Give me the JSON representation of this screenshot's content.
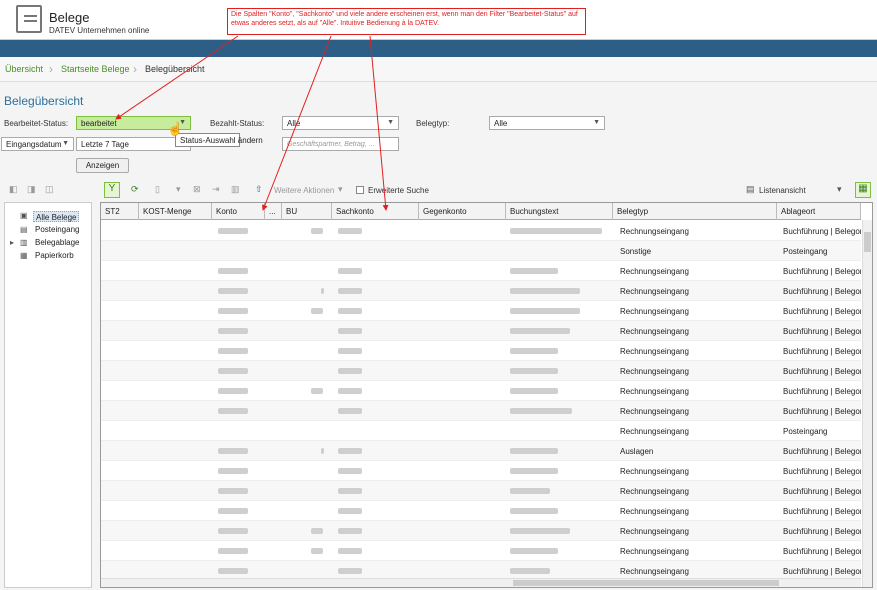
{
  "app": {
    "title": "Belege",
    "subtitle": "DATEV Unternehmen online"
  },
  "annotation": "Die Spalten \"Konto\", \"Sachkonto\" und viele andere erscheinen erst, wenn man den Filter \"Bearbeitet-Status\" auf etwas anderes setzt, als auf \"Alle\". Intuitive Bedienung à la DATEV.",
  "breadcrumb": [
    "Übersicht",
    "Startseite Belege",
    "Belegübersicht"
  ],
  "page_title": "Belegübersicht",
  "filters": {
    "bearbeitet_label": "Bearbeitet-Status:",
    "bearbeitet_value": "bearbeitet",
    "bezahlt_label": "Bezahlt-Status:",
    "bezahlt_value": "Alle",
    "belegtyp_label": "Belegtyp:",
    "belegtyp_value": "Alle",
    "date_field": "Eingangsdatum",
    "date_range": "Letzte 7 Tage",
    "search_placeholder": "Geschäftspartner, Betrag, ...",
    "show_button": "Anzeigen",
    "tooltip": "Status-Auswahl ändern"
  },
  "toolbar": {
    "more_actions": "Weitere Aktionen",
    "extended_search": "Erweiterte Suche",
    "view": "Listenansicht"
  },
  "tree": [
    "Alle Belege",
    "Posteingang",
    "Belegablage",
    "Papierkorb"
  ],
  "columns": [
    "ST2",
    "KOST-Menge",
    "Konto",
    "...",
    "BU",
    "Sachkonto",
    "Gegenkonto",
    "Buchungstext",
    "Belegtyp",
    "Ablageort"
  ],
  "rows": [
    {
      "belegtyp": "Rechnungseingang",
      "ablageort": "Buchführung | Belegor"
    },
    {
      "belegtyp": "Sonstige",
      "ablageort": "Posteingang"
    },
    {
      "belegtyp": "Rechnungseingang",
      "ablageort": "Buchführung | Belegor"
    },
    {
      "belegtyp": "Rechnungseingang",
      "ablageort": "Buchführung | Belegor"
    },
    {
      "belegtyp": "Rechnungseingang",
      "ablageort": "Buchführung | Belegor"
    },
    {
      "belegtyp": "Rechnungseingang",
      "ablageort": "Buchführung | Belegor"
    },
    {
      "belegtyp": "Rechnungseingang",
      "ablageort": "Buchführung | Belegor"
    },
    {
      "belegtyp": "Rechnungseingang",
      "ablageort": "Buchführung | Belegor"
    },
    {
      "belegtyp": "Rechnungseingang",
      "ablageort": "Buchführung | Belegor"
    },
    {
      "belegtyp": "Rechnungseingang",
      "ablageort": "Buchführung | Belegor"
    },
    {
      "belegtyp": "Rechnungseingang",
      "ablageort": "Posteingang"
    },
    {
      "belegtyp": "Auslagen",
      "ablageort": "Buchführung | Belegor"
    },
    {
      "belegtyp": "Rechnungseingang",
      "ablageort": "Buchführung | Belegor"
    },
    {
      "belegtyp": "Rechnungseingang",
      "ablageort": "Buchführung | Belegor"
    },
    {
      "belegtyp": "Rechnungseingang",
      "ablageort": "Buchführung | Belegor"
    },
    {
      "belegtyp": "Rechnungseingang",
      "ablageort": "Buchführung | Belegor"
    },
    {
      "belegtyp": "Rechnungseingang",
      "ablageort": "Buchführung | Belegor"
    },
    {
      "belegtyp": "Rechnungseingang",
      "ablageort": "Buchführung | Belegor"
    }
  ]
}
